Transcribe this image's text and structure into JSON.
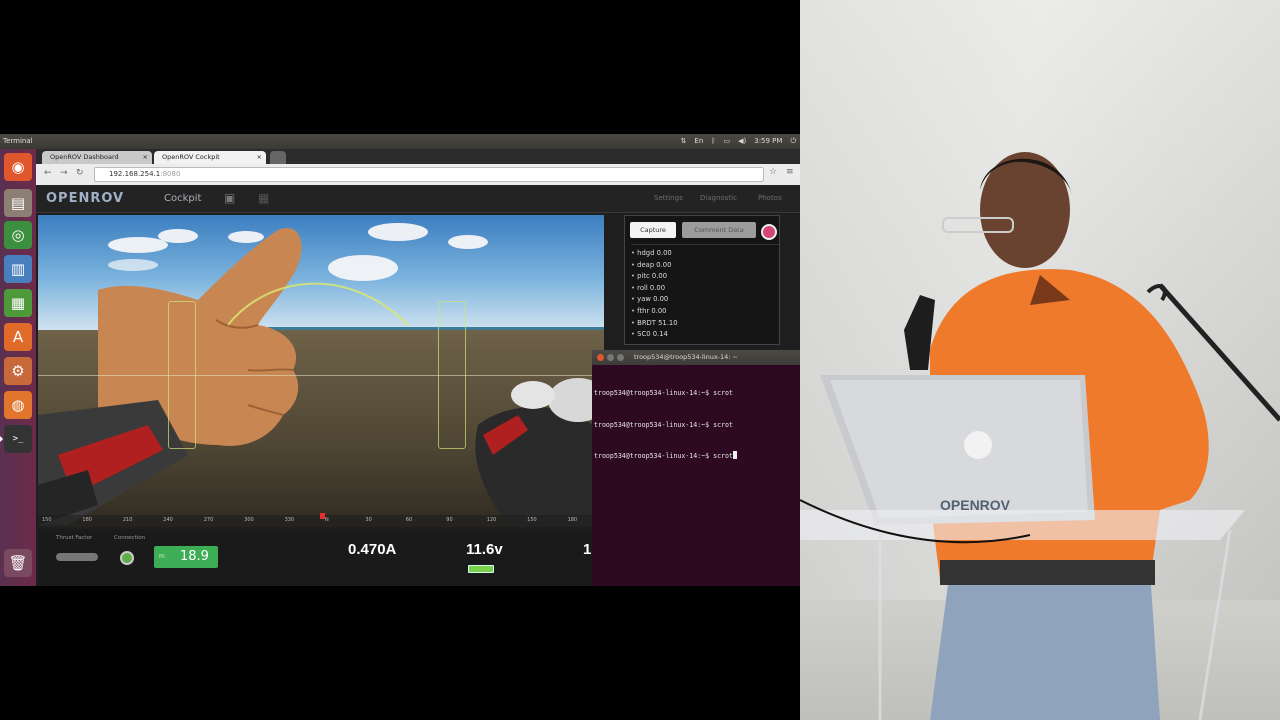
{
  "topbar": {
    "app_name": "Terminal",
    "language": "En",
    "time": "3:59 PM"
  },
  "launcher": {
    "items": [
      {
        "name": "dash-icon",
        "glyph": "◉",
        "color": "#e0572d"
      },
      {
        "name": "files-icon",
        "glyph": "▤",
        "color": "#8c7f74"
      },
      {
        "name": "chrome-icon",
        "glyph": "◎",
        "color": "#3d8f40"
      },
      {
        "name": "writer-icon",
        "glyph": "▥",
        "color": "#4a7fbf"
      },
      {
        "name": "calc-icon",
        "glyph": "▦",
        "color": "#4e9a3a"
      },
      {
        "name": "software-center-icon",
        "glyph": "A",
        "color": "#e06a2a"
      },
      {
        "name": "settings-icon",
        "glyph": "⚙",
        "color": "#c7693a"
      },
      {
        "name": "firefox-icon",
        "glyph": "◍",
        "color": "#e2752d"
      },
      {
        "name": "terminal-icon",
        "glyph": ">_",
        "color": "#333333"
      }
    ],
    "trash_glyph": "🗑"
  },
  "browser": {
    "tabs": [
      {
        "label": "OpenROV Dashboard"
      },
      {
        "label": "OpenROV Cockpit"
      }
    ],
    "url_host": "192.168.254.1",
    "url_port": ":8080"
  },
  "cockpit": {
    "logo": "OPENROV",
    "subtitle": "Cockpit",
    "links": [
      "Settings",
      "Diagnostic",
      "Photos"
    ],
    "panel": {
      "capture_label": "Capture",
      "comment_label": "Comment Data",
      "telemetry": [
        "hdgd 0.00",
        "deap 0.00",
        "pitc 0.00",
        "roll 0.00",
        "yaw 0.00",
        "fthr 0.00",
        "BRDT 51.10",
        "SC0 0.14"
      ]
    },
    "status": {
      "thrust_label": "Thrust Factor",
      "connection_label": "Connection",
      "depth_unit": "m",
      "depth": "18.9",
      "current": "0.470A",
      "voltage": "11.6v",
      "partial": "1"
    },
    "compass_ticks": [
      "150",
      "180",
      "210",
      "240",
      "270",
      "300",
      "330",
      "N",
      "30",
      "60",
      "90",
      "120",
      "150",
      "180"
    ]
  },
  "terminal": {
    "title": "troop534@troop534-linux-14: ~",
    "lines": [
      "troop534@troop534-linux-14:~$ scrot",
      "troop534@troop534-linux-14:~$ scrot",
      "troop534@troop534-linux-14:~$ scrot"
    ]
  },
  "photo": {
    "laptop_sticker": "OPENROV"
  }
}
